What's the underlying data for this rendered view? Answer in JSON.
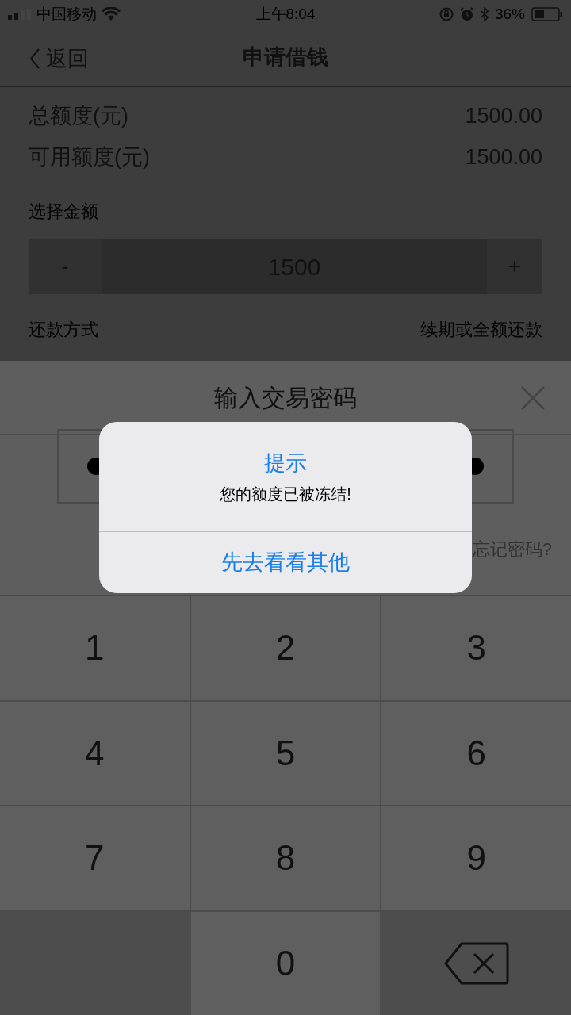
{
  "status_bar": {
    "carrier": "中国移动",
    "time": "上午8:04",
    "battery": "36%"
  },
  "nav": {
    "back": "返回",
    "title": "申请借钱"
  },
  "summary": [
    {
      "label": "总额度(元)",
      "value": "1500.00"
    },
    {
      "label": "可用额度(元)",
      "value": "1500.00"
    }
  ],
  "amount": {
    "label": "选择金额",
    "minus": "-",
    "value": "1500",
    "plus": "+"
  },
  "repayment": {
    "label": "还款方式",
    "value": "续期或全额还款"
  },
  "sheet": {
    "title": "输入交易密码",
    "first_cell": {
      "filled": true
    },
    "last_cell": {
      "filled": true
    },
    "forgot": "忘记密码?",
    "keys": [
      {
        "kind": "digit",
        "label": "1"
      },
      {
        "kind": "digit",
        "label": "2"
      },
      {
        "kind": "digit",
        "label": "3"
      },
      {
        "kind": "digit",
        "label": "4"
      },
      {
        "kind": "digit",
        "label": "5"
      },
      {
        "kind": "digit",
        "label": "6"
      },
      {
        "kind": "digit",
        "label": "7"
      },
      {
        "kind": "digit",
        "label": "8"
      },
      {
        "kind": "digit",
        "label": "9"
      },
      {
        "kind": "blank"
      },
      {
        "kind": "digit",
        "label": "0"
      },
      {
        "kind": "delete"
      }
    ]
  },
  "alert": {
    "title": "提示",
    "message": "您的额度已被冻结!",
    "button": "先去看看其他"
  }
}
